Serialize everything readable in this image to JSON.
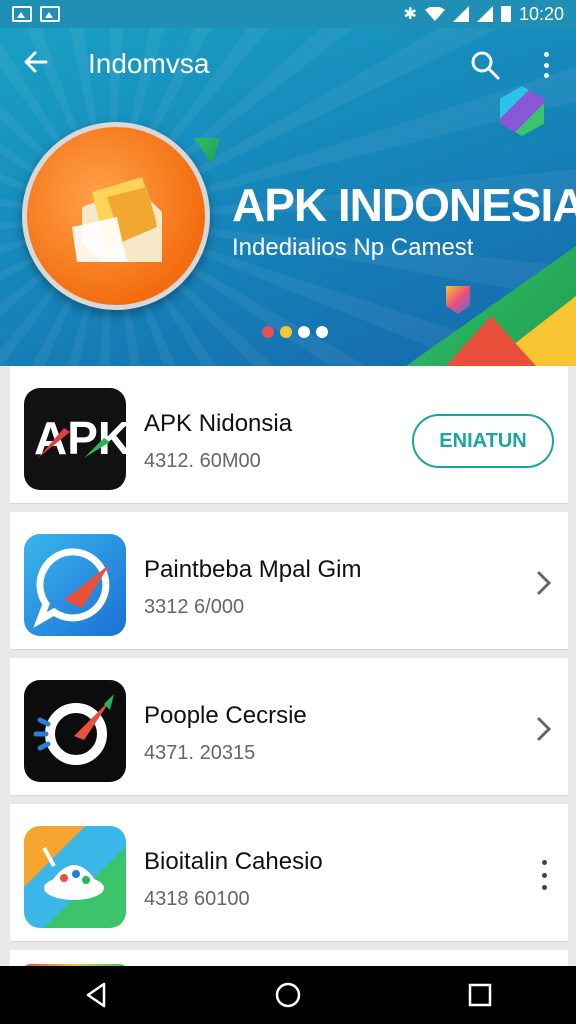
{
  "status_bar": {
    "time": "10:20"
  },
  "header": {
    "title": "Indomvsa",
    "back_icon": "arrow-back-icon",
    "search_icon": "search-icon",
    "more_icon": "more-vert-icon"
  },
  "banner": {
    "title": "APK INDONESIA",
    "subtitle": "Indedialios Np Camest",
    "dots": [
      "#e94f5a",
      "#f6c531",
      "#ffffff",
      "#ffffff"
    ]
  },
  "apps": [
    {
      "name": "APK Nidonsia",
      "meta": "4312. 60M00",
      "action": "ENIATUN",
      "action_type": "button"
    },
    {
      "name": "Paintbeba Mpal Gim",
      "meta": "3312 6/000",
      "action_type": "chevron"
    },
    {
      "name": "Poople Cecrsie",
      "meta": "4371. 20315",
      "action_type": "chevron"
    },
    {
      "name": "Bioitalin Cahesio",
      "meta": "4318 60100",
      "action_type": "menu"
    }
  ],
  "colors": {
    "accent": "#1aa6a0",
    "banner": "#1582b8",
    "orange": "#f36d10"
  },
  "nav": {
    "back": "nav-back-icon",
    "home": "nav-home-icon",
    "recents": "nav-recents-icon"
  }
}
